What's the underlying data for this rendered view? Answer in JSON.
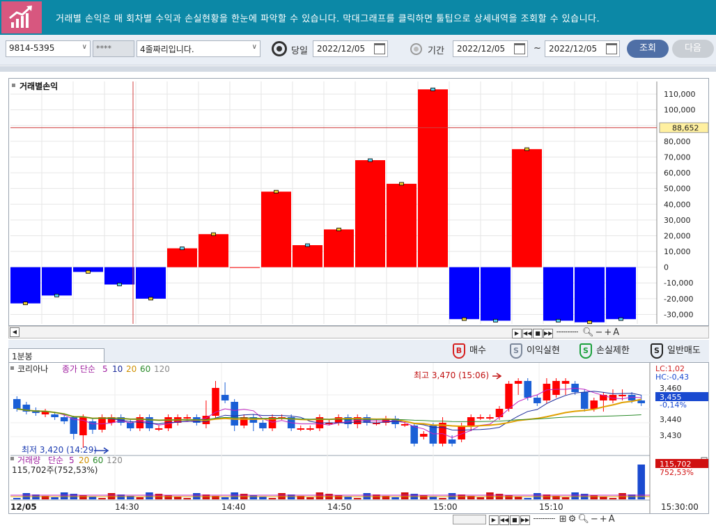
{
  "banner": {
    "logo_icon": "chart-growth-icon",
    "text": "거래별 손익은 매 회차별 수익과 손실현황을 한눈에 파악할 수 있습니다. 막대그래프를 클릭하면 툴팁으로 상세내역을 조회할 수 있습니다."
  },
  "toolbar": {
    "account": "9814-5395",
    "password_mask": "****",
    "account_name": "4줄짜리입니다.",
    "today_label": "당일",
    "today_date": "2022/12/05",
    "period_label": "기간",
    "period_start": "2022/12/05",
    "period_sep": "~",
    "period_end": "2022/12/05",
    "search_label": "조회",
    "next_label": "다음"
  },
  "colors": {
    "profit": "#ff0000",
    "loss": "#0000ff",
    "up_candle": "#ff0000",
    "down_candle": "#1a5fd6",
    "banner": "#0c88a6"
  },
  "chart_data": [
    {
      "type": "bar",
      "title": "거래별손익",
      "values": [
        -23000,
        -18000,
        -3000,
        -11000,
        -20000,
        12000,
        21000,
        0,
        48000,
        14000,
        24000,
        68000,
        53000,
        113000,
        -33000,
        -34000,
        75000,
        -34000,
        -35000,
        -33000
      ],
      "ylim": [
        -35000,
        115000
      ],
      "yticks": [
        "110,000",
        "100,000",
        "90,000",
        "80,000",
        "70,000",
        "60,000",
        "50,000",
        "40,000",
        "30,000",
        "20,000",
        "10,000",
        "0",
        "-10,000",
        "-20,000",
        "-30,000"
      ],
      "crosshair_value": "88,652"
    },
    {
      "type": "candlestick",
      "tab": "1분봉",
      "symbol": "코리아나",
      "ma_label": "종가 단순",
      "ma_periods": [
        "5",
        "10",
        "20",
        "60",
        "120"
      ],
      "lc": "LC:1,02",
      "hc": "HC:-0,43",
      "current_price": "3,455",
      "change_pct": "-0,14%",
      "high_note": "최고 3,470 (15:06)",
      "low_note": "최저 3,420 (14:29)",
      "yticks": [
        "3,460",
        "3,440",
        "3,430"
      ],
      "x_labels": [
        "12/05",
        "14:30",
        "14:40",
        "14:50",
        "15:00",
        "15:10",
        "15:30:00"
      ],
      "candles": [
        [
          3457,
          3450,
          3459,
          3448
        ],
        [
          3453,
          3448,
          3455,
          3446
        ],
        [
          3449,
          3447,
          3451,
          3445
        ],
        [
          3446,
          3448,
          3450,
          3444
        ],
        [
          3446,
          3444,
          3448,
          3442
        ],
        [
          3444,
          3441,
          3446,
          3439
        ],
        [
          3444,
          3432,
          3445,
          3428
        ],
        [
          3431,
          3444,
          3446,
          3422
        ],
        [
          3441,
          3435,
          3443,
          3432
        ],
        [
          3435,
          3444,
          3446,
          3433
        ],
        [
          3440,
          3444,
          3446,
          3438
        ],
        [
          3444,
          3440,
          3446,
          3438
        ],
        [
          3440,
          3436,
          3442,
          3434
        ],
        [
          3436,
          3444,
          3446,
          3434
        ],
        [
          3444,
          3436,
          3446,
          3434
        ],
        [
          3436,
          3436,
          3438,
          3434
        ],
        [
          3436,
          3444,
          3446,
          3434
        ],
        [
          3440,
          3444,
          3446,
          3438
        ],
        [
          3444,
          3444,
          3446,
          3442
        ],
        [
          3444,
          3440,
          3446,
          3438
        ],
        [
          3439,
          3445,
          3456,
          3436
        ],
        [
          3445,
          3465,
          3470,
          3443
        ],
        [
          3460,
          3456,
          3469,
          3454
        ],
        [
          3455,
          3438,
          3457,
          3434
        ],
        [
          3438,
          3444,
          3446,
          3436
        ],
        [
          3444,
          3440,
          3446,
          3434
        ],
        [
          3440,
          3436,
          3442,
          3434
        ],
        [
          3436,
          3444,
          3446,
          3434
        ],
        [
          3444,
          3444,
          3446,
          3442
        ],
        [
          3444,
          3436,
          3446,
          3434
        ],
        [
          3436,
          3436,
          3438,
          3434
        ],
        [
          3436,
          3436,
          3438,
          3434
        ],
        [
          3436,
          3444,
          3446,
          3434
        ],
        [
          3440,
          3440,
          3442,
          3438
        ],
        [
          3440,
          3444,
          3446,
          3438
        ],
        [
          3444,
          3439,
          3446,
          3436
        ],
        [
          3439,
          3444,
          3446,
          3436
        ],
        [
          3444,
          3440,
          3446,
          3438
        ],
        [
          3440,
          3440,
          3442,
          3438
        ],
        [
          3440,
          3443,
          3445,
          3438
        ],
        [
          3443,
          3439,
          3445,
          3436
        ],
        [
          3439,
          3439,
          3441,
          3437
        ],
        [
          3438,
          3425,
          3440,
          3423
        ],
        [
          3430,
          3432,
          3434,
          3428
        ],
        [
          3438,
          3425,
          3440,
          3423
        ],
        [
          3425,
          3440,
          3444,
          3423
        ],
        [
          3428,
          3425,
          3431,
          3423
        ],
        [
          3428,
          3438,
          3440,
          3426
        ],
        [
          3438,
          3444,
          3446,
          3434
        ],
        [
          3444,
          3444,
          3446,
          3442
        ],
        [
          3444,
          3444,
          3446,
          3442
        ],
        [
          3444,
          3450,
          3452,
          3442
        ],
        [
          3450,
          3468,
          3470,
          3448
        ],
        [
          3468,
          3470,
          3472,
          3460
        ],
        [
          3470,
          3458,
          3472,
          3456
        ],
        [
          3458,
          3454,
          3460,
          3452
        ],
        [
          3456,
          3468,
          3472,
          3454
        ],
        [
          3460,
          3470,
          3472,
          3458
        ],
        [
          3468,
          3470,
          3472,
          3460
        ],
        [
          3468,
          3462,
          3470,
          3460
        ],
        [
          3462,
          3450,
          3464,
          3448
        ],
        [
          3450,
          3456,
          3458,
          3448
        ],
        [
          3456,
          3460,
          3462,
          3448
        ],
        [
          3456,
          3460,
          3464,
          3454
        ],
        [
          3460,
          3460,
          3464,
          3456
        ],
        [
          3460,
          3456,
          3462,
          3454
        ],
        [
          3456,
          3454,
          3460,
          3452
        ]
      ]
    },
    {
      "type": "bar",
      "title": "거래량",
      "ma_label": "단순",
      "ma_periods": [
        "5",
        "20",
        "60",
        "120"
      ],
      "volume_note": "115,702주(752,53%)",
      "last_value": "115,702",
      "last_pct": "752,53%"
    }
  ],
  "legend": [
    {
      "icon": "B",
      "label": "매수",
      "color": "#d62020"
    },
    {
      "icon": "S",
      "label": "이익실현",
      "color": "#7a8699"
    },
    {
      "icon": "S",
      "label": "손실제한",
      "color": "#19a03a"
    },
    {
      "icon": "S",
      "label": "일반매도",
      "color": "#222222"
    }
  ]
}
